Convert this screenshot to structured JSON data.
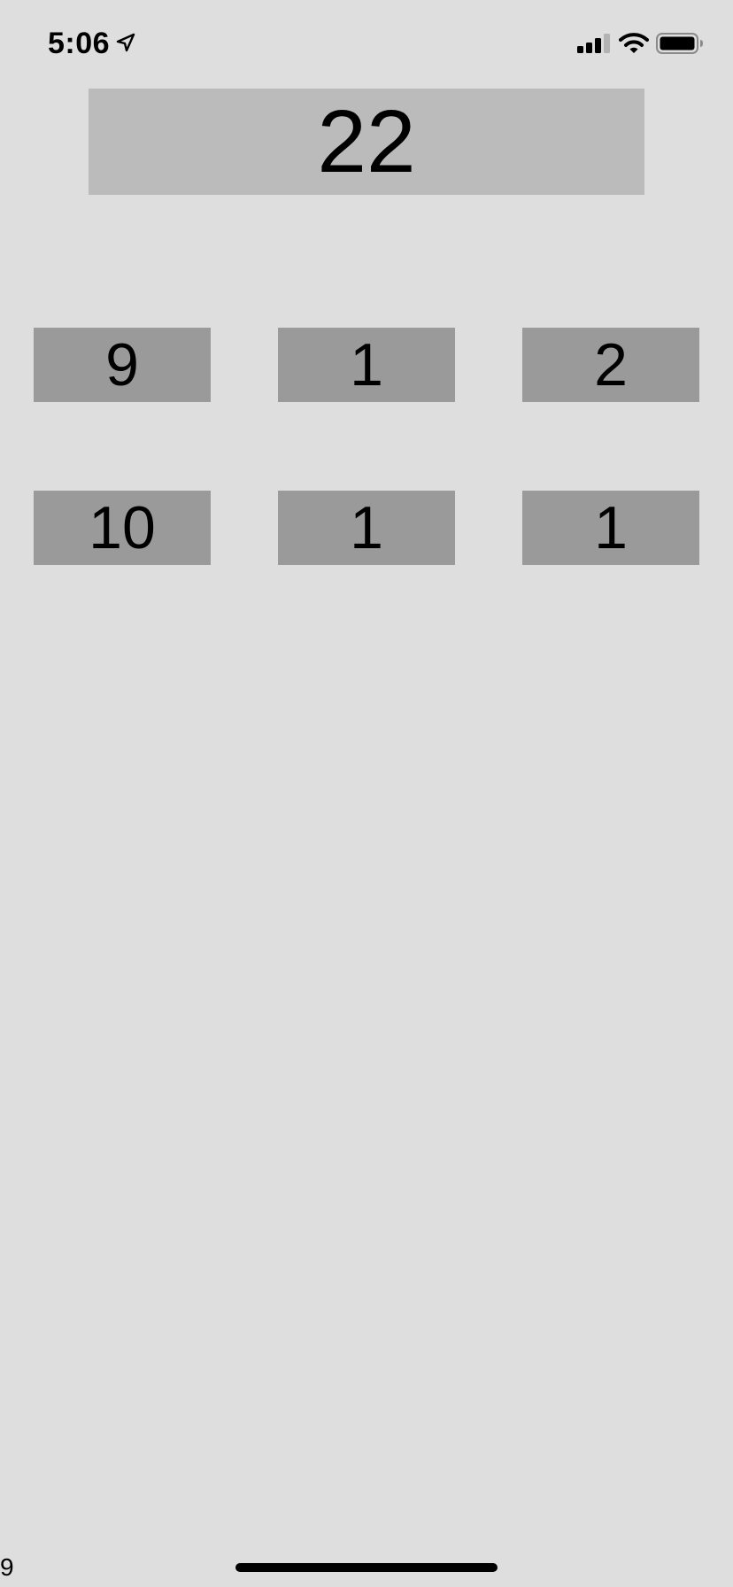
{
  "status_bar": {
    "time": "5:06",
    "icons": [
      "location-arrow-icon",
      "cellular-signal-icon",
      "wifi-icon",
      "battery-icon"
    ]
  },
  "total": "22",
  "grid": {
    "row1": [
      "9",
      "1",
      "2"
    ],
    "row2": [
      "10",
      "1",
      "1"
    ]
  },
  "footer_text": "9",
  "colors": {
    "background": "#dedede",
    "total_box": "#bbbbbb",
    "cell_box": "#9a9a9a",
    "text": "#000000"
  }
}
